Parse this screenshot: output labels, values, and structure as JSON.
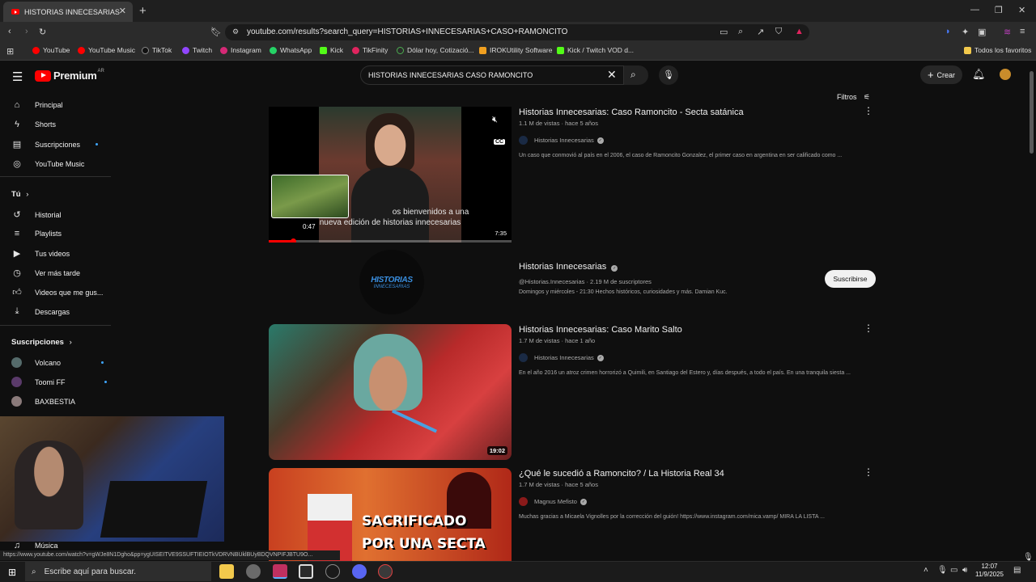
{
  "browser": {
    "tab_title": "HISTORIAS INNECESARIAS CASO",
    "url": "youtube.com/results?search_query=HISTORIAS+INNECESARIAS+CASO+RAMONCITO",
    "status_url": "https://www.youtube.com/watch?v=gWJe8N1Dgho&pp=ygUISEITVE9SSUFTIEIOTkVDRVNBUklBUyBDQVNPIFJBTU9O...",
    "bookmarks": [
      "YouTube",
      "YouTube Music",
      "TikTok",
      "Twitch",
      "Instagram",
      "WhatsApp",
      "Kick",
      "TikFinity",
      "Dólar hoy, Cotizació...",
      "IROKUtility Software",
      "Kick / Twitch VOD d..."
    ],
    "all_bookmarks": "Todos los favoritos"
  },
  "header": {
    "logo_text": "Premium",
    "region": "AR",
    "search_value": "HISTORIAS INNECESARIAS CASO RAMONCITO",
    "create_label": "Crear"
  },
  "sidebar": {
    "main": [
      "Principal",
      "Shorts",
      "Suscripciones",
      "YouTube Music"
    ],
    "you_header": "Tú",
    "you": [
      "Historial",
      "Playlists",
      "Tus videos",
      "Ver más tarde",
      "Videos que me gus...",
      "Descargas"
    ],
    "subs_header": "Suscripciones",
    "subs": [
      "Volcano",
      "Toomi FF",
      "BAXBESTIA"
    ],
    "music": "Música"
  },
  "filters_label": "Filtros",
  "results": [
    {
      "title": "Historias Innecesarias: Caso Ramoncito - Secta satánica",
      "meta": "1.1 M de vistas · hace 5 años",
      "channel": "Historias Innecesarias",
      "desc": "Un caso que conmovió al país en el 2006, el caso de Ramoncito Gonzalez, el primer caso en argentina en ser calificado como ...",
      "duration": "7:35",
      "preview_time": "0:47",
      "subtitle_line1": "os bienvenidos a una",
      "subtitle_line2": "nueva edición de historias innecesarias",
      "progress": 0.1
    },
    {
      "title": "Historias Innecesarias: Caso Marito Salto",
      "meta": "1.7 M de vistas · hace 1 año",
      "channel": "Historias Innecesarias",
      "desc": "En el año 2016 un atroz crimen horrorizó a Quimili, en Santiago del Estero y, días después, a todo el país. En una tranquila siesta ...",
      "duration": "19:02"
    },
    {
      "title": "¿Qué le sucedió a Ramoncito? / La Historia Real 34",
      "meta": "1.7 M de vistas · hace 5 años",
      "channel": "Magnus Mefisto",
      "desc": "Muchas gracias a Micaela Vignolles por la corrección del guión! https://www.instagram.com/mica.vamp/ MIRA LA LISTA ...",
      "thumb_text1": "SACRIFICADO",
      "thumb_text2": "POR UNA SECTA"
    }
  ],
  "channel_card": {
    "name": "Historias Innecesarias",
    "meta": "@Historias.Innecesarias · 2.19 M de suscriptores",
    "desc": "Domingos y miércoles - 21:30 Hechos históricos, curiosidades y más. Damian Kuc.",
    "logo_text1": "HISTORIAS",
    "logo_text2": "INNECESARIAS",
    "subscribe_label": "Suscribirse"
  },
  "taskbar": {
    "search_placeholder": "Escribe aquí para buscar.",
    "time": "12:07",
    "date": "11/9/2025"
  },
  "colors": {
    "accent_red": "#ff0000",
    "bg": "#0f0f0f",
    "link_blue": "#3ea6ff"
  }
}
